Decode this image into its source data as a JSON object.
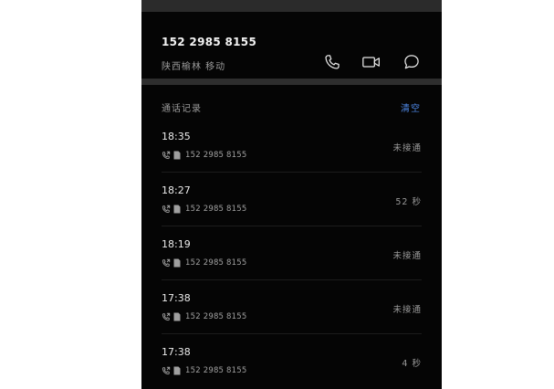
{
  "contact": {
    "number": "152 2985 8155",
    "location": "陕西榆林 移动"
  },
  "actions": [
    {
      "icon": "phone-icon"
    },
    {
      "icon": "video-icon"
    },
    {
      "icon": "message-icon"
    }
  ],
  "call_log": {
    "title": "通话记录",
    "clear_label": "清空",
    "entries": [
      {
        "time": "18:35",
        "number": "152 2985 8155",
        "status": "未接通"
      },
      {
        "time": "18:27",
        "number": "152 2985 8155",
        "status": "52 秒"
      },
      {
        "time": "18:19",
        "number": "152 2985 8155",
        "status": "未接通"
      },
      {
        "time": "17:38",
        "number": "152 2985 8155",
        "status": "未接通"
      },
      {
        "time": "17:38",
        "number": "152 2985 8155",
        "status": "4 秒"
      }
    ]
  },
  "colors": {
    "background": "#050505",
    "accent": "#4e88e6",
    "primary_text": "#f2f2f2",
    "secondary_text": "#9a9a9a"
  }
}
